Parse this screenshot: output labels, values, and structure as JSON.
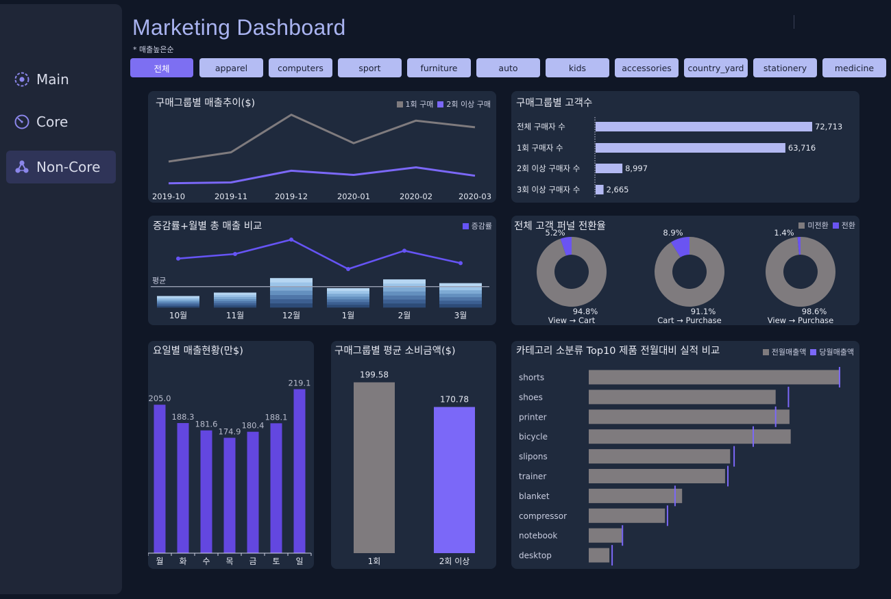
{
  "sidebar": {
    "items": [
      {
        "label": "Main",
        "icon": "target-icon"
      },
      {
        "label": "Core",
        "icon": "gauge-icon"
      },
      {
        "label": "Non-Core",
        "icon": "network-icon"
      }
    ]
  },
  "header": {
    "title": "Marketing Dashboard",
    "subtitle": "* 매출높은순"
  },
  "filters": [
    "전체",
    "apparel",
    "computers",
    "sport",
    "furniture",
    "auto",
    "kids",
    "accessories",
    "country_yard",
    "stationery",
    "medicine"
  ],
  "colors": {
    "accent": "#7d6ff2",
    "filter": "#b4bcf3",
    "gray": "#7f7b7e",
    "purple": "#7b68f8",
    "bar_light": "#b3b9f2",
    "weekday": "#6347e0"
  },
  "panels": {
    "sales_trend": {
      "title": "구매그룹별 매출추이($)",
      "legend": [
        "1회 구매",
        "2회 이상 구매"
      ]
    },
    "customer_count": {
      "title": "구매그룹별 고객수"
    },
    "growth": {
      "title": "증감률+월별 총 매출 비교",
      "legend": "증감률",
      "avg_label": "평균"
    },
    "funnel": {
      "title": "전체 고객 퍼널 전환율",
      "legend": [
        "미전환",
        "전환"
      ]
    },
    "weekday": {
      "title": "요일별 매출현황(만$)"
    },
    "avg_spend": {
      "title": "구매그룹별 평균 소비금액($)"
    },
    "top10": {
      "title": "카테고리 소분류 Top10 제품 전월대비 실적 비교",
      "legend": [
        "전월매출액",
        "당월매출액"
      ]
    }
  },
  "chart_data": [
    {
      "id": "sales_trend",
      "type": "line",
      "x": [
        "2019-10",
        "2019-11",
        "2019-12",
        "2020-01",
        "2020-02",
        "2020-03"
      ],
      "series": [
        {
          "name": "1회 구매",
          "values": [
            0.32,
            0.43,
            0.88,
            0.54,
            0.81,
            0.73
          ]
        },
        {
          "name": "2회 이상 구매",
          "values": [
            0.06,
            0.07,
            0.21,
            0.16,
            0.25,
            0.15
          ]
        }
      ]
    },
    {
      "id": "customer_count",
      "type": "bar",
      "categories": [
        "전체 구매자 수",
        "1회 구매자 수",
        "2회 이상 구매자 수",
        "3회 이상 구매자 수"
      ],
      "values": [
        72713,
        63716,
        8997,
        2665
      ],
      "labels": [
        "72,713",
        "63,716",
        "8,997",
        "2,665"
      ]
    },
    {
      "id": "growth",
      "type": "bar",
      "categories": [
        "10월",
        "11월",
        "12월",
        "1월",
        "2월",
        "3월"
      ],
      "values": [
        0.36,
        0.47,
        0.93,
        0.61,
        0.89,
        0.77
      ],
      "average": 0.66,
      "line": {
        "name": "증감률",
        "values": [
          0.59,
          0.66,
          0.88,
          0.43,
          0.71,
          0.52
        ]
      }
    },
    {
      "id": "funnel",
      "type": "pie",
      "donuts": [
        {
          "label": "View → Cart",
          "converted": 5.2,
          "not_converted": 94.8,
          "converted_label": "5.2%",
          "not_converted_label": "94.8%"
        },
        {
          "label": "Cart → Purchase",
          "converted": 8.9,
          "not_converted": 91.1,
          "converted_label": "8.9%",
          "not_converted_label": "91.1%"
        },
        {
          "label": "View → Purchase",
          "converted": 1.4,
          "not_converted": 98.6,
          "converted_label": "1.4%",
          "not_converted_label": "98.6%"
        }
      ]
    },
    {
      "id": "weekday",
      "type": "bar",
      "categories": [
        "월",
        "화",
        "수",
        "목",
        "금",
        "토",
        "일"
      ],
      "values": [
        205.0,
        188.3,
        181.6,
        174.9,
        180.4,
        188.1,
        219.1
      ],
      "labels": [
        "205.0",
        "188.3",
        "181.6",
        "174.9",
        "180.4",
        "188.1",
        "219.1"
      ],
      "ylim": [
        70,
        230
      ]
    },
    {
      "id": "avg_spend",
      "type": "bar",
      "categories": [
        "1회",
        "2회 이상"
      ],
      "values": [
        199.58,
        170.78
      ],
      "labels": [
        "199.58",
        "170.78"
      ],
      "ylim": [
        0,
        210
      ]
    },
    {
      "id": "top10",
      "type": "bar",
      "categories": [
        "shorts",
        "shoes",
        "printer",
        "bicycle",
        "slipons",
        "trainer",
        "blanket",
        "compressor",
        "notebook",
        "desktop"
      ],
      "series": [
        {
          "name": "전월매출액",
          "values": [
            100,
            74.3,
            79.8,
            80.3,
            56.2,
            54.2,
            37.1,
            30.3,
            13.1,
            8.2
          ]
        },
        {
          "name": "당월매출액",
          "values": [
            99.7,
            79.4,
            74.3,
            65.4,
            57.8,
            55.3,
            34.3,
            31.3,
            13.4,
            9.3
          ]
        }
      ]
    }
  ]
}
